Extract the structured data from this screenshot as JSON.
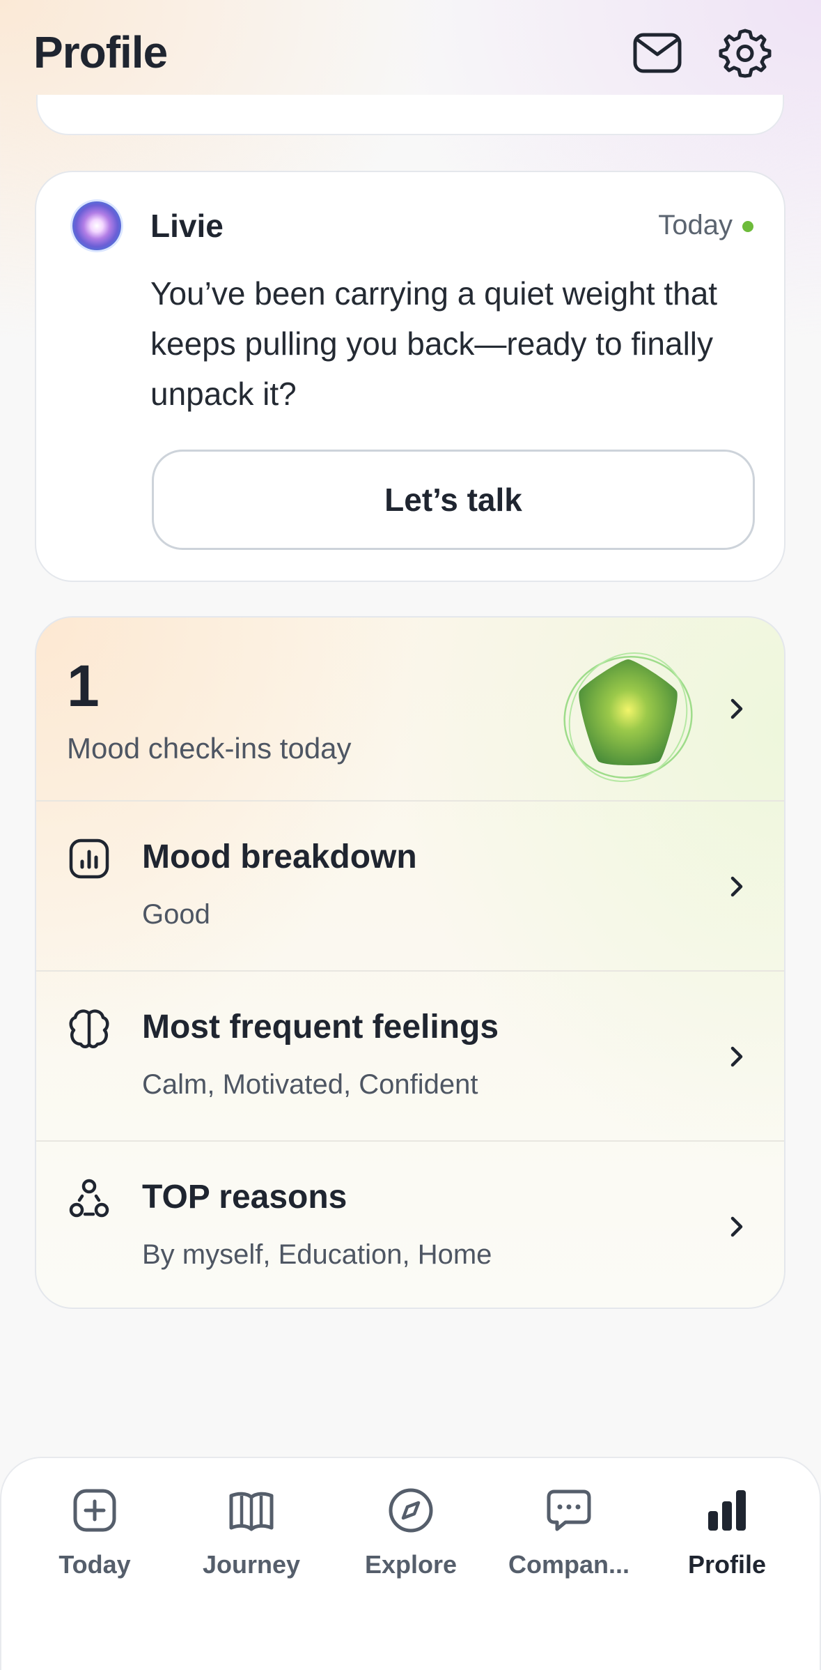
{
  "header": {
    "title": "Profile",
    "icons": [
      "mail-icon",
      "gear-icon"
    ]
  },
  "livie": {
    "name": "Livie",
    "time": "Today",
    "status_color": "#6dbb3a",
    "message": "You’ve been carrying a quiet weight that keeps pulling you back—ready to finally unpack it?",
    "button_label": "Let’s talk"
  },
  "mood": {
    "count": "1",
    "count_label": "Mood check-ins today",
    "rows": [
      {
        "title": "Mood breakdown",
        "subtitle": "Good",
        "icon": "chart-icon"
      },
      {
        "title": "Most frequent feelings",
        "subtitle": "Calm, Motivated, Confident",
        "icon": "brain-icon"
      },
      {
        "title": "TOP reasons",
        "subtitle": "By myself, Education, Home",
        "icon": "people-icon"
      }
    ]
  },
  "nav": {
    "items": [
      {
        "label": "Today",
        "icon": "plus-square-icon"
      },
      {
        "label": "Journey",
        "icon": "book-icon"
      },
      {
        "label": "Explore",
        "icon": "compass-icon"
      },
      {
        "label": "Compan...",
        "icon": "chat-icon"
      },
      {
        "label": "Profile",
        "icon": "bar-chart-icon",
        "active": true
      }
    ]
  }
}
